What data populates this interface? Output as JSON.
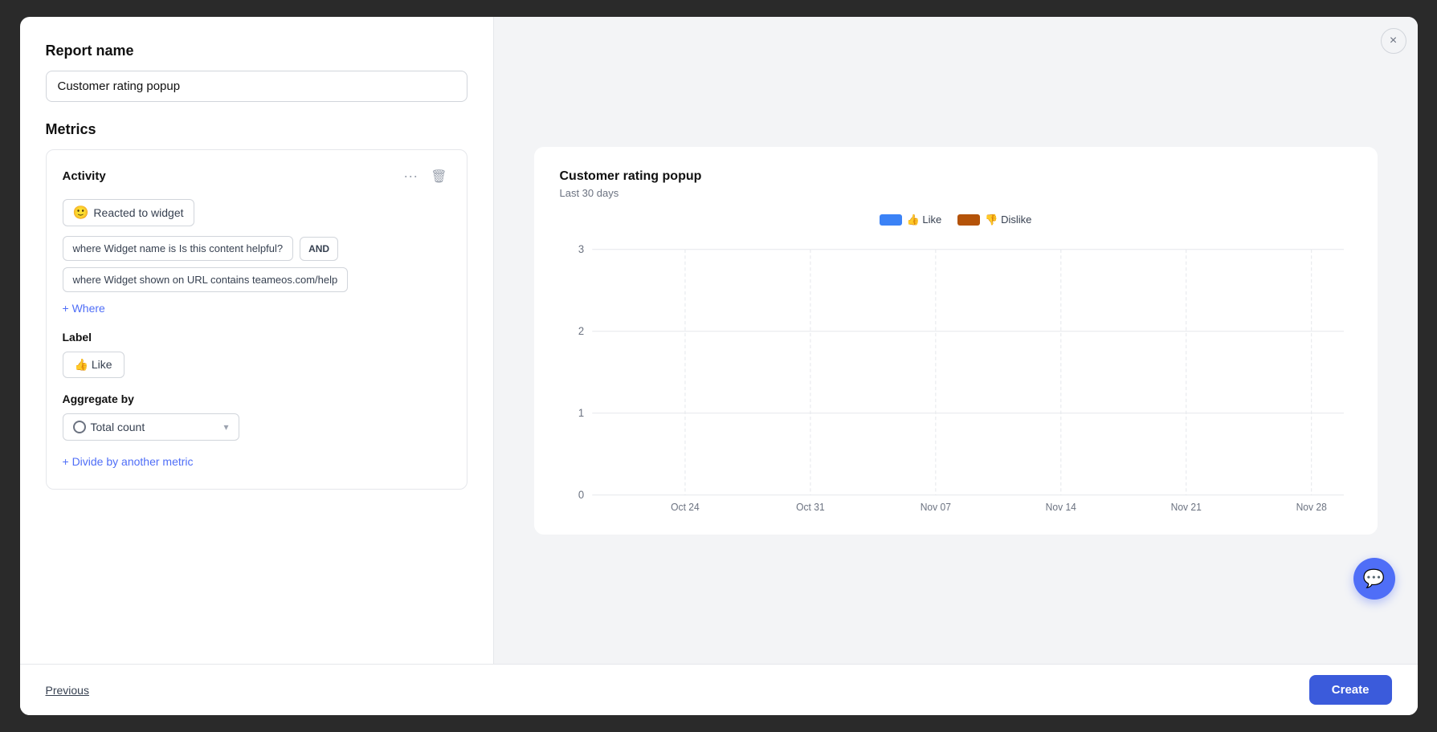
{
  "modal": {
    "close_label": "×"
  },
  "left_panel": {
    "report_name_label": "Report name",
    "report_name_value": "Customer rating popup",
    "metrics_label": "Metrics",
    "metric_card": {
      "activity_label": "Activity",
      "reacted_label": "Reacted to widget",
      "where_condition_1": "where Widget name is Is this content helpful?",
      "and_label": "AND",
      "where_condition_2": "where Widget shown on URL contains teameos.com/help",
      "add_where_label": "+ Where",
      "label_section": "Label",
      "label_value": "👍 Like",
      "aggregate_label": "Aggregate by",
      "aggregate_value": "Total count",
      "divide_label": "+ Divide by another metric"
    }
  },
  "right_panel": {
    "chart_title": "Customer rating popup",
    "chart_subtitle": "Last 30 days",
    "legend": [
      {
        "label": "👍 Like",
        "color": "#3b82f6"
      },
      {
        "label": "👎 Dislike",
        "color": "#b45309"
      }
    ],
    "y_axis": [
      "3",
      "2",
      "1",
      "0"
    ],
    "x_axis": [
      "Oct 24",
      "Oct 31",
      "Nov 07",
      "Nov 14",
      "Nov 21",
      "Nov 28"
    ]
  },
  "footer": {
    "previous_label": "Previous",
    "create_label": "Create"
  },
  "icons": {
    "dots": "···",
    "trash": "🗑",
    "smiley": "🙂",
    "like_emoji": "👍",
    "dislike_emoji": "👎",
    "chat": "💬",
    "chevron_down": "▾"
  }
}
